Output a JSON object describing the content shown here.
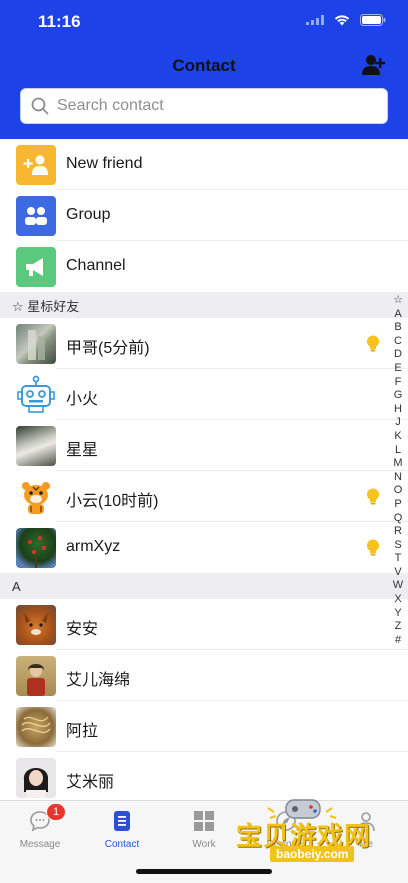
{
  "status": {
    "time": "11:16"
  },
  "header": {
    "title": "Contact",
    "add_icon": "add-user-icon"
  },
  "search": {
    "placeholder": "Search contact"
  },
  "shortcuts": [
    {
      "label": "New friend",
      "icon": "add-friend-icon",
      "color": "#f7b731"
    },
    {
      "label": "Group",
      "icon": "group-icon",
      "color": "#3d6ae0"
    },
    {
      "label": "Channel",
      "icon": "megaphone-icon",
      "color": "#5bc97d"
    }
  ],
  "sections": [
    {
      "title": "☆ 星标好友",
      "contacts": [
        {
          "name": "甲哥(5分前)",
          "avatar": "photo-building",
          "bulb": true
        },
        {
          "name": "小火",
          "avatar": "robot-avatar",
          "bulb": false
        },
        {
          "name": "星星",
          "avatar": "photo-hand",
          "bulb": false
        },
        {
          "name": "小云(10时前)",
          "avatar": "tiger-avatar",
          "bulb": true
        },
        {
          "name": "armXyz",
          "avatar": "photo-tree",
          "bulb": true
        }
      ]
    },
    {
      "title": "A",
      "contacts": [
        {
          "name": "安安",
          "avatar": "photo-dog",
          "bulb": false
        },
        {
          "name": "艾儿海绵",
          "avatar": "photo-painting",
          "bulb": false
        },
        {
          "name": "阿拉",
          "avatar": "photo-food",
          "bulb": false
        },
        {
          "name": "艾米丽",
          "avatar": "photo-girl",
          "bulb": false
        }
      ]
    }
  ],
  "index_letters": [
    "☆",
    "A",
    "B",
    "C",
    "D",
    "E",
    "F",
    "G",
    "H",
    "J",
    "K",
    "L",
    "M",
    "N",
    "O",
    "P",
    "Q",
    "R",
    "S",
    "T",
    "V",
    "W",
    "X",
    "Y",
    "Z",
    "#"
  ],
  "tabs": [
    {
      "label": "Message",
      "icon": "message-icon",
      "badge": "1",
      "active": false
    },
    {
      "label": "Contact",
      "icon": "contact-book-icon",
      "badge": "",
      "active": true
    },
    {
      "label": "Work",
      "icon": "grid-icon",
      "badge": "",
      "active": false
    },
    {
      "label": "Discover",
      "icon": "discover-icon",
      "badge": "",
      "active": false
    },
    {
      "label": "Me",
      "icon": "person-icon",
      "badge": "",
      "active": false
    }
  ],
  "watermark": {
    "text": "宝贝游戏网",
    "url": "baobeiy.com"
  },
  "colors": {
    "header": "#1d42e8",
    "active_tab": "#2b4fd6",
    "badge": "#e8362c"
  }
}
